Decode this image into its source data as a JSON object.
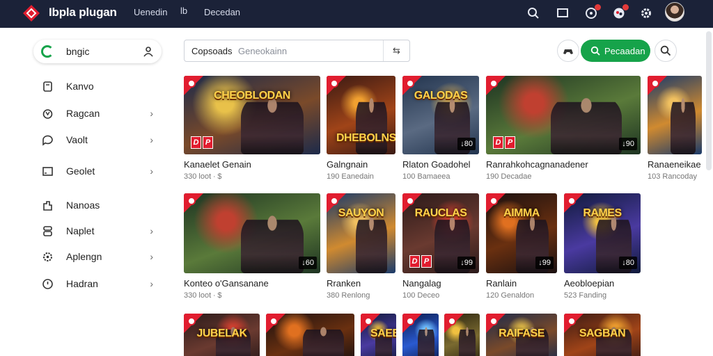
{
  "app": {
    "title": "Ibpla plugan"
  },
  "topnav": {
    "link1": "Uenedin",
    "icon_text": "lb",
    "link2": "Decedan"
  },
  "colors": {
    "topbar": "#1b2238",
    "accent": "#16a34a",
    "badge": "#e11d2f"
  },
  "sidebar": {
    "search_label": "bngic",
    "items": [
      {
        "label": "Kanvo",
        "icon": "bookmark-icon",
        "chevron": ""
      },
      {
        "label": "Ragcan",
        "icon": "trophy-icon",
        "chevron": "›"
      },
      {
        "label": "Vaolt",
        "icon": "chat-icon",
        "chevron": "›"
      },
      {
        "label": "Geolet",
        "icon": "window-icon",
        "chevron": "›"
      },
      {
        "label": "Nanoas",
        "icon": "puzzle-icon",
        "chevron": ""
      },
      {
        "label": "Naplet",
        "icon": "layers-icon",
        "chevron": "›"
      },
      {
        "label": "Aplengn",
        "icon": "gear-icon",
        "chevron": "›"
      },
      {
        "label": "Hadran",
        "icon": "clock-icon",
        "chevron": "›"
      }
    ]
  },
  "search": {
    "value": "Copsoads",
    "placeholder": "Geneokainn",
    "end_icon": "⇆"
  },
  "actions": {
    "primary_label": "Pecaadan"
  },
  "cards_row1": [
    {
      "title": "Kanaelet Genain",
      "meta": "330 loot ∙ $",
      "banner": "CHEOBLODAN",
      "count": ""
    },
    {
      "title": "Galngnain",
      "meta": "190 Eanedain",
      "banner": "DHEBOLNS",
      "count": ""
    },
    {
      "title": "Rlaton Goadohel",
      "meta": "100 Bamaeea",
      "banner": "GALODAS",
      "count": "↓80"
    },
    {
      "title": "Ranrahkohcagnanadener",
      "meta": "190 Decadae",
      "banner": "",
      "count": "↓90"
    },
    {
      "title": "Ranaeneikae",
      "meta": "103 Rancoday",
      "banner": "",
      "count": ""
    }
  ],
  "cards_row2": [
    {
      "title": "Konteo o'Gansanane",
      "meta": "330 loot ∙ $",
      "banner": "",
      "count": "↓60"
    },
    {
      "title": "Rranken",
      "meta": "380 Renlong",
      "banner": "SAUYON",
      "count": ""
    },
    {
      "title": "Nangalag",
      "meta": "100 Deceo",
      "banner": "RAUCLAS",
      "count": "↓99"
    },
    {
      "title": "Ranlain",
      "meta": "120 Genaldon",
      "banner": "AIMMA",
      "count": "↓99"
    },
    {
      "title": "Aeobloepian",
      "meta": "523 Fanding",
      "banner": "RAMES",
      "count": "↓80"
    }
  ],
  "cards_row3": [
    {
      "banner": "JUBELAK"
    },
    {
      "banner": ""
    },
    {
      "banner": "SAEBR"
    },
    {
      "banner": ""
    },
    {
      "banner": ""
    },
    {
      "banner": "RAIFASE"
    },
    {
      "banner": "SAGBAN"
    }
  ],
  "badge_letters": [
    "D",
    "P"
  ]
}
